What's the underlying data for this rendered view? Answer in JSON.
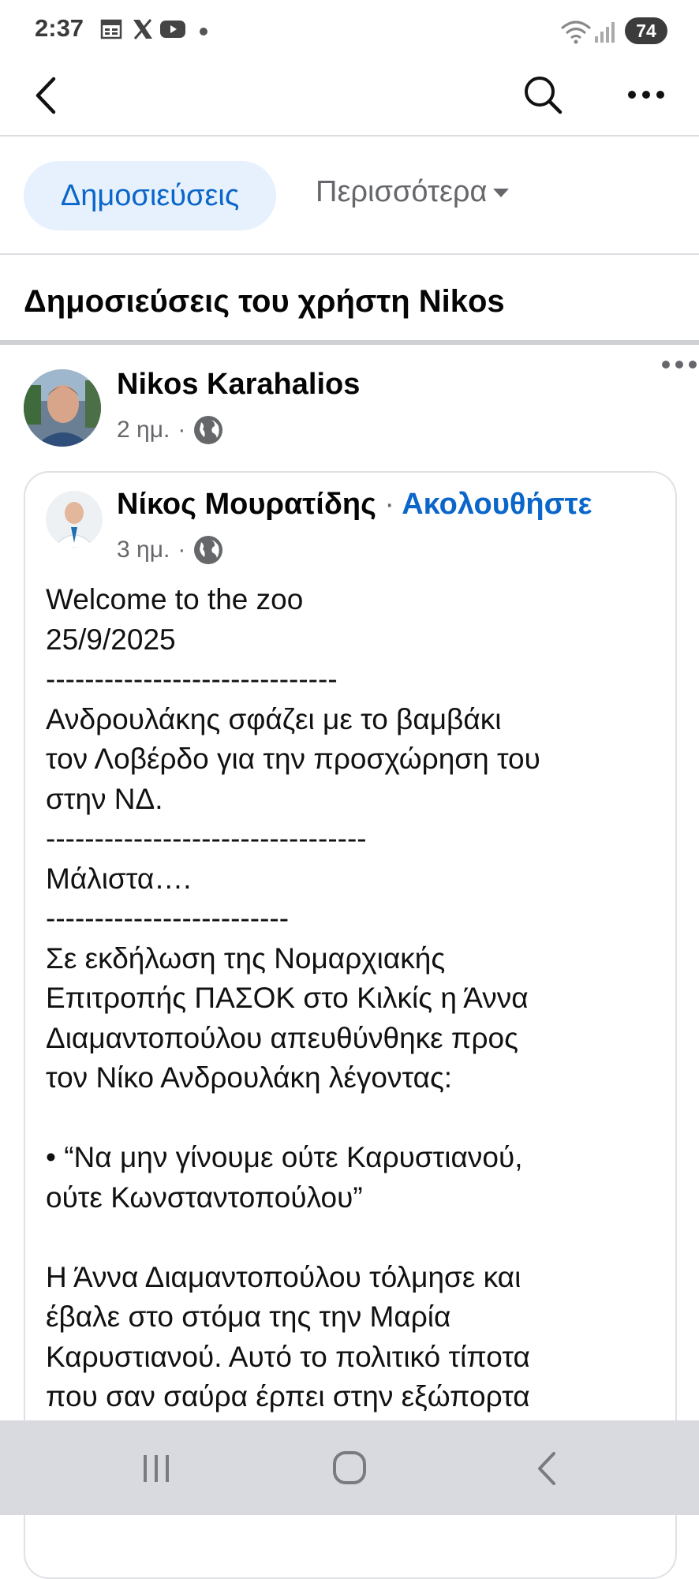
{
  "status_bar": {
    "time": "2:37",
    "icons": [
      "calendar-icon",
      "x-logo-icon",
      "youtube-icon",
      "dot-icon",
      "wifi-icon",
      "signal-icon"
    ],
    "battery": "74"
  },
  "toolbar": {
    "back": "back-icon",
    "search": "search-icon",
    "more": "more-icon"
  },
  "tabs": {
    "posts": "Δημοσιεύσεις",
    "more": "Περισσότερα"
  },
  "section_title": "Δημοσιεύσεις του χρήστη Nikos",
  "post": {
    "author": "Nikos Karahalios",
    "time": "2 ημ.",
    "separator": "·",
    "shared": {
      "author": "Νίκος Μουρατίδης",
      "separator": "·",
      "follow": "Ακολουθήστε",
      "time": "3 ημ.",
      "lines": [
        "Welcome to the zoo",
        "25/9/2025",
        "------------------------------",
        "Ανδρουλάκης σφάζει με το βαμβάκι",
        "τον Λοβέρδο για την προσχώρηση του",
        "στην ΝΔ.",
        "---------------------------------",
        "Μάλιστα….",
        "-------------------------",
        "Σε εκδήλωση της Νομαρχιακής",
        "Επιτροπής ΠΑΣΟΚ στο Κιλκίς η Άννα",
        "Διαμαντοπούλου απευθύνθηκε προς",
        "τον Νίκο Ανδρουλάκη λέγοντας:",
        "",
        "• “Να μην γίνουμε ούτε Καρυστιανού,",
        "ούτε Κωνσταντοπούλου”",
        "",
        "Η Άννα Διαμαντοπούλου τόλμησε και",
        "έβαλε στο στόμα της την Μαρία",
        "Καρυστιανού. Αυτό το πολιτικό τίποτα",
        "που σαν σαύρα έρπει στην εξώπορτα"
      ]
    }
  },
  "colors": {
    "accent": "#0a66c9",
    "tab_bg": "#e7f1fd",
    "muted": "#65676b",
    "nav_bg": "#d9dadf"
  }
}
